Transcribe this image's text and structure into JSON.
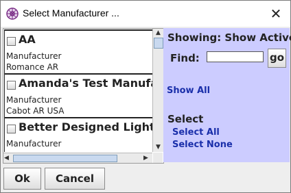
{
  "window": {
    "title": "Select Manufacturer ...",
    "close_glyph": "✕"
  },
  "list": {
    "items": [
      {
        "name": "AA",
        "line1": "Manufacturer",
        "line2": "Romance  AR",
        "checked": false
      },
      {
        "name": "Amanda's Test Manufac",
        "line1": "Manufacturer",
        "line2": "Cabot  AR  USA",
        "checked": false
      },
      {
        "name": "Better Designed Lightin",
        "line1": "Manufacturer",
        "line2": "",
        "checked": false
      }
    ]
  },
  "panel": {
    "showing": "Showing: Show Active",
    "find_label": "Find:",
    "find_value": "",
    "go_label": "go",
    "show_all": "Show All",
    "select_label": "Select",
    "select_all": "Select All",
    "select_none": "Select None"
  },
  "buttons": {
    "ok": "Ok",
    "cancel": "Cancel"
  },
  "colors": {
    "panel_bg": "#ccccff",
    "link": "#1a2faa"
  },
  "icons": {
    "title": "app-gear-icon",
    "close": "close-icon",
    "scroll_up": "arrow-up-icon",
    "scroll_down": "arrow-down-icon",
    "scroll_left": "arrow-left-icon",
    "scroll_right": "arrow-right-icon"
  }
}
